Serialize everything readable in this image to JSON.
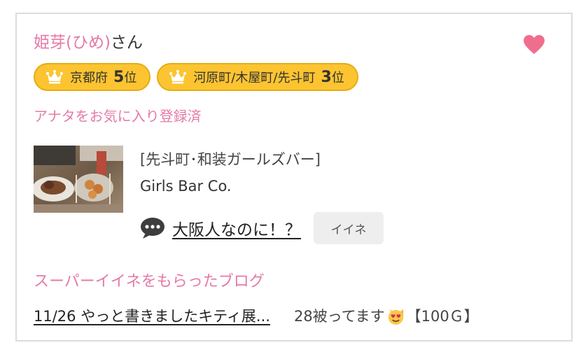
{
  "profile": {
    "name_primary": "姫芽(ひめ)",
    "name_suffix": "さん",
    "favorite_status": "アナタをお気に入り登録済"
  },
  "badges": [
    {
      "area": "京都府",
      "rank_number": "5",
      "rank_suffix": "位"
    },
    {
      "area": "河原町/木屋町/先斗町",
      "rank_number": "3",
      "rank_suffix": "位"
    }
  ],
  "shop": {
    "category": "[先斗町･和装ガールズバー]",
    "name": "Girls Bar Co."
  },
  "blog": {
    "title": "大阪人なのに！？",
    "iine_label": "イイネ"
  },
  "super_iine": {
    "heading": "スーパーイイネをもらったブログ",
    "entry_link": "11/26 やっと書きましたキティ展...",
    "count_text": "28被ってます",
    "points_text": "【100Ｇ】"
  },
  "colors": {
    "accent_pink": "#e57aa6",
    "badge_yellow": "#fcc430",
    "heart": "#ef6e8e"
  },
  "icons": [
    "heart-icon",
    "crown-icon",
    "speech-bubble-icon",
    "heart-eyes-cat-icon"
  ]
}
